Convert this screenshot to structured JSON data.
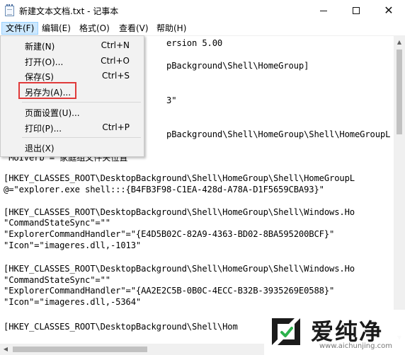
{
  "window": {
    "title": "新建文本文档.txt - 记事本",
    "buttons": {
      "minimize": "—",
      "maximize": "☐",
      "close": "✕"
    }
  },
  "menubar": [
    {
      "label": "文件(F)"
    },
    {
      "label": "编辑(E)"
    },
    {
      "label": "格式(O)"
    },
    {
      "label": "查看(V)"
    },
    {
      "label": "帮助(H)"
    }
  ],
  "file_menu": [
    {
      "label": "新建(N)",
      "shortcut": "Ctrl+N"
    },
    {
      "label": "打开(O)...",
      "shortcut": "Ctrl+O"
    },
    {
      "label": "保存(S)",
      "shortcut": "Ctrl+S"
    },
    {
      "label": "另存为(A)...",
      "shortcut": ""
    },
    {
      "label": "页面设置(U)...",
      "shortcut": ""
    },
    {
      "label": "打印(P)...",
      "shortcut": "Ctrl+P"
    },
    {
      "label": "退出(X)",
      "shortcut": ""
    }
  ],
  "editor_lines": [
    "                                ersion 5.00",
    "",
    "                                pBackground\\Shell\\HomeGroup]",
    "",
    "",
    "                                3\"",
    "",
    "",
    "                                pBackground\\Shell\\HomeGroup\\Shell\\HomeGroupL",
    "",
    "\"MUIVerb\"=\"家庭组文件夹位置\"",
    "",
    "[HKEY_CLASSES_ROOT\\DesktopBackground\\Shell\\HomeGroup\\Shell\\HomeGroupL",
    "@=\"explorer.exe shell:::{B4FB3F98-C1EA-428d-A78A-D1F5659CBA93}\"",
    "",
    "[HKEY_CLASSES_ROOT\\DesktopBackground\\Shell\\HomeGroup\\Shell\\Windows.Ho",
    "\"CommandStateSync\"=\"\"",
    "\"ExplorerCommandHandler\"=\"{E4D5B02C-82A9-4363-BD02-8BA595200BCF}\"",
    "\"Icon\"=\"imageres.dll,-1013\"",
    "",
    "[HKEY_CLASSES_ROOT\\DesktopBackground\\Shell\\HomeGroup\\Shell\\Windows.Ho",
    "\"CommandStateSync\"=\"\"",
    "\"ExplorerCommandHandler\"=\"{AA2E2C5B-0B0C-4ECC-B32B-3935269E0588}\"",
    "\"Icon\"=\"imageres.dll,-5364\"",
    "",
    "[HKEY_CLASSES_ROOT\\DesktopBackground\\Shell\\Hom"
  ],
  "watermark": {
    "text": "爱纯净",
    "url": "www.aichunjing.com"
  },
  "colors": {
    "menu_active_bg": "#cce8ff",
    "dropdown_bg": "#f2f2f2",
    "highlight_border": "#e03a3a"
  }
}
